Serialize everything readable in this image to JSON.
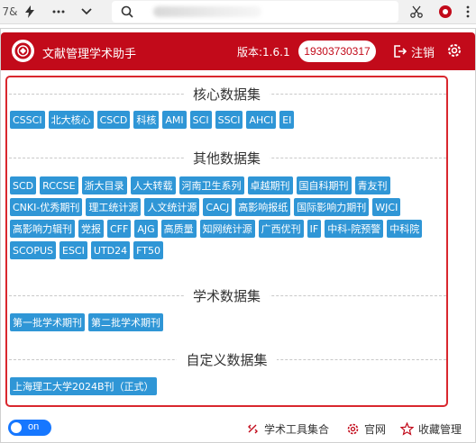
{
  "browser": {
    "partial_text": "7&",
    "icons": [
      "lightning-icon",
      "more-icon",
      "chevron-down-icon",
      "search-icon",
      "scissors-icon",
      "extension-icon",
      "menu-icon"
    ]
  },
  "header": {
    "title": "文献管理学术助手",
    "version": "版本:1.6.1",
    "phone": "19303730317",
    "logout_label": "注销",
    "accent_color": "#c20a1a"
  },
  "sections": [
    {
      "title": "核心数据集",
      "tags": [
        "CSSCI",
        "北大核心",
        "CSCD",
        "科核",
        "AMI",
        "SCI",
        "SSCI",
        "AHCI",
        "EI"
      ]
    },
    {
      "title": "其他数据集",
      "tags": [
        "SCD",
        "RCCSE",
        "浙大目录",
        "人大转载",
        "河南卫生系列",
        "卓越期刊",
        "国自科期刊",
        "青友刊",
        "CNKI-优秀期刊",
        "理工统计源",
        "人文统计源",
        "CACJ",
        "高影响报纸",
        "国际影响力期刊",
        "WJCI",
        "高影响力辑刊",
        "党报",
        "CFF",
        "AJG",
        "高质量",
        "知网统计源",
        "广西优刊",
        "IF",
        "中科-院预警",
        "中科院",
        "SCOPUS",
        "ESCI",
        "UTD24",
        "FT50"
      ]
    },
    {
      "title": "学术数据集",
      "tags": [
        "第一批学术期刊",
        "第二批学术期刊"
      ]
    },
    {
      "title": "自定义数据集",
      "tags": [
        "上海理工大学2024B刊（正式）"
      ]
    }
  ],
  "footer": {
    "toggle_label": "on",
    "tools_label": "学术工具集合",
    "website_label": "官网",
    "favorites_label": "收藏管理"
  },
  "colors": {
    "tag_bg": "#2f96d6",
    "panel_border": "#d9272e",
    "toggle_bg": "#1677ff"
  }
}
